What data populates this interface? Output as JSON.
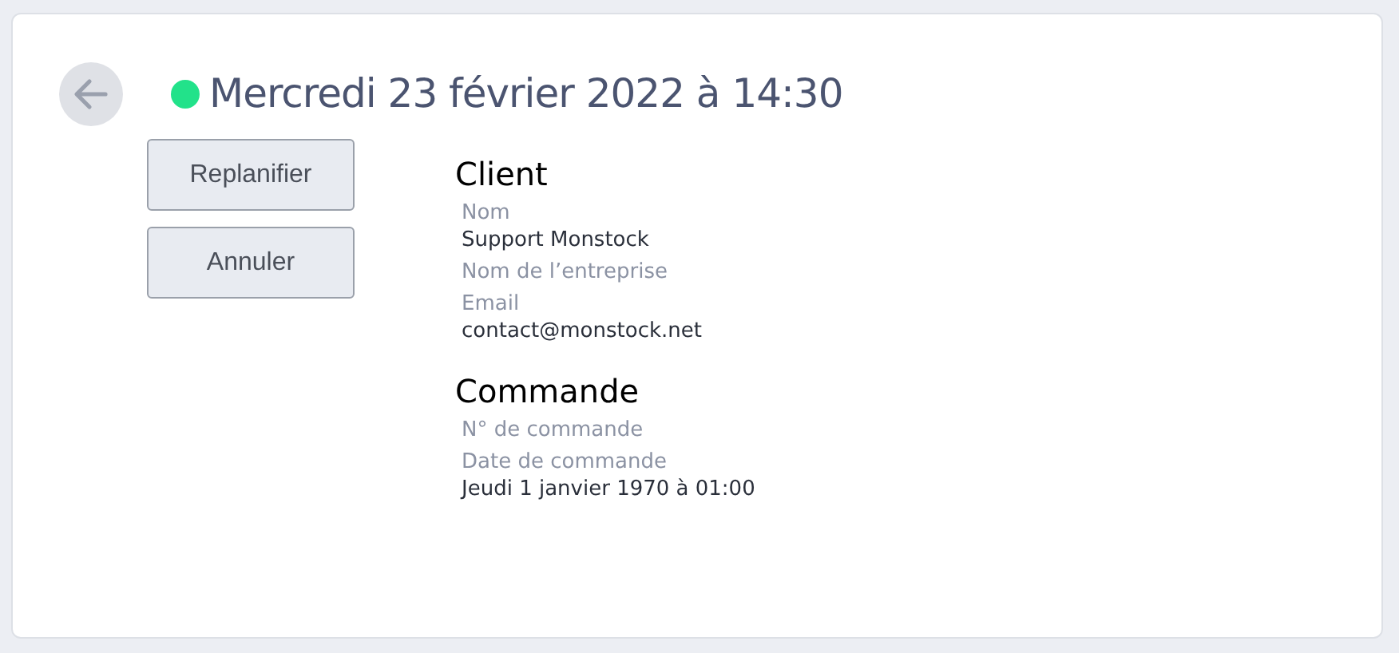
{
  "header": {
    "title": "Mercredi 23 février 2022 à 14:30",
    "status": {
      "color": "#22e28a"
    }
  },
  "actions": [
    "Replanifier",
    "Annuler"
  ],
  "sections": [
    {
      "title": "Client",
      "fields": [
        {
          "label": "Nom",
          "value": "Support Monstock"
        },
        {
          "label": "Nom de l’entreprise"
        },
        {
          "label": "Email",
          "value": "contact@monstock.net"
        }
      ]
    },
    {
      "title": "Commande",
      "fields": [
        {
          "label": "N° de commande"
        },
        {
          "label": "Date de commande",
          "value": "Jeudi 1 janvier 1970 à 01:00"
        }
      ]
    }
  ]
}
